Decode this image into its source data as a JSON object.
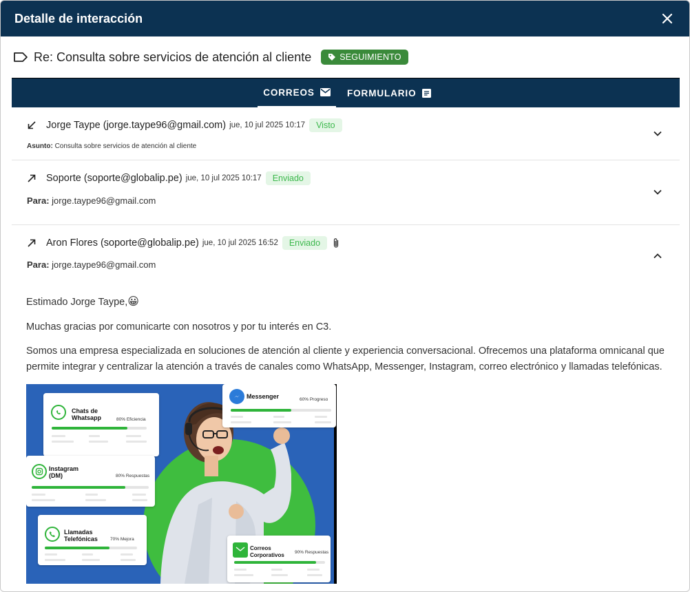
{
  "modal": {
    "title": "Detalle de interacción",
    "close_icon": "close-icon"
  },
  "subject": {
    "text": "Re: Consulta sobre servicios de atención al cliente",
    "tag_label": "SEGUIMIENTO"
  },
  "tabs": [
    {
      "label": "CORREOS",
      "icon": "mail-icon",
      "active": true
    },
    {
      "label": "FORMULARIO",
      "icon": "document-icon",
      "active": false
    }
  ],
  "emails": [
    {
      "direction": "incoming",
      "sender": "Jorge Taype (jorge.taype96@gmail.com)",
      "date": "jue, 10 jul 2025 10:17",
      "status": "Visto",
      "meta_label": "Asunto:",
      "meta_value": "Consulta sobre servicios de atención al cliente",
      "expanded": false
    },
    {
      "direction": "outgoing",
      "sender": "Soporte (soporte@globalip.pe)",
      "date": "jue, 10 jul 2025 10:17",
      "status": "Enviado",
      "meta_label": "Para:",
      "meta_value": "jorge.taype96@gmail.com",
      "expanded": false
    },
    {
      "direction": "outgoing",
      "sender": "Aron Flores (soporte@globalip.pe)",
      "date": "jue, 10 jul 2025 16:52",
      "status": "Enviado",
      "has_attachment": true,
      "meta_label": "Para:",
      "meta_value": "jorge.taype96@gmail.com",
      "expanded": true,
      "body": {
        "greeting": "Estimado Jorge Taype,",
        "greeting_emoji": "😀",
        "p1": "Muchas gracias por comunicarte con nosotros y por tu interés en C3.",
        "p2": "Somos una empresa especializada en soluciones de atención al cliente y experiencia conversacional. Ofrecemos una plataforma omnicanal que permite integrar y centralizar la atención a través de canales como WhatsApp, Messenger, Instagram, correo electrónico y llamadas telefónicas."
      }
    }
  ],
  "promo_cards": [
    {
      "title_line1": "Chats de",
      "title_line2": "Whatsapp",
      "stat": "80% Eficiencia",
      "progress": 0.8,
      "icon": "whatsapp-icon"
    },
    {
      "title_line1": "Messenger",
      "title_line2": "",
      "stat": "60% Progreso",
      "progress": 0.6,
      "icon": "messenger-icon"
    },
    {
      "title_line1": "Instagram",
      "title_line2": "(DM)",
      "stat": "80% Respuestas",
      "progress": 0.8,
      "icon": "instagram-icon"
    },
    {
      "title_line1": "Llamadas",
      "title_line2": "Telefónicas",
      "stat": "70% Mejora",
      "progress": 0.7,
      "icon": "phone-icon"
    },
    {
      "title_line1": "Correos",
      "title_line2": "Corporativos",
      "stat": "90% Respuestas",
      "progress": 0.9,
      "icon": "mail-icon"
    }
  ],
  "colors": {
    "header_bg": "#0c3252",
    "tag_bg": "#3a8a3a",
    "status_green": "#3cb84c",
    "status_bg": "#e4f6e6",
    "promo_blue": "#2a63b8",
    "promo_green": "#3fbd3f"
  }
}
